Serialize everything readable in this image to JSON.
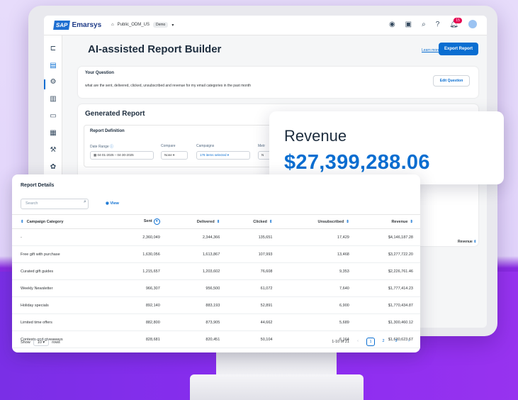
{
  "app": {
    "brand_sap": "SAP",
    "brand_name": "Emarsys",
    "tenant": "Public_ODM_US",
    "tenant_tag": "Demo"
  },
  "topbar": {
    "notifications": "15"
  },
  "page": {
    "title": "AI-assisted Report Builder",
    "learn_more": "Learn more",
    "export_label": "Export Report"
  },
  "question": {
    "label": "Your Question",
    "text": "what are the sent, delivered, clicked, unsubscribed and revenue for my email categories in the past month",
    "edit_label": "Edit Question"
  },
  "generated": {
    "title": "Generated Report",
    "definition_title": "Report Definition",
    "date_range_label": "Date Range",
    "date_range_value": "04-01-2025 – 04-30-2025",
    "compare_label": "Compare",
    "compare_value": "None",
    "campaigns_label": "Campaigns",
    "campaigns_value": "178 items selected",
    "metrics_label": "Metr",
    "metrics_value": "N",
    "revenue_header": "Revenue"
  },
  "revenue_popup": {
    "label": "Revenue",
    "value": "$27,399,288.06"
  },
  "details": {
    "title": "Report Details",
    "search_placeholder": "Search",
    "view_label": "View",
    "columns": [
      "Campaign Category",
      "Sent",
      "Delivered",
      "Clicked",
      "Unsubscribed",
      "Revenue"
    ],
    "rows": [
      [
        "-",
        "2,360,049",
        "2,344,366",
        "135,651",
        "17,429",
        "$4,146,187.28"
      ],
      [
        "Free gift with purchase",
        "1,630,056",
        "1,613,867",
        "107,993",
        "13,468",
        "$3,277,722.20"
      ],
      [
        "Curated gift guides",
        "1,215,657",
        "1,203,602",
        "76,608",
        "9,353",
        "$2,226,761.46"
      ],
      [
        "Weekly Newsletter",
        "966,307",
        "956,500",
        "61,072",
        "7,640",
        "$1,777,414.23"
      ],
      [
        "Holiday specials",
        "892,140",
        "883,193",
        "52,891",
        "6,900",
        "$1,770,434.87"
      ],
      [
        "Limited time offers",
        "882,800",
        "873,905",
        "44,662",
        "5,689",
        "$1,300,460.12"
      ],
      [
        "Contests and giveaways",
        "828,681",
        "820,451",
        "50,104",
        "6,164",
        "$1,630,623.67"
      ]
    ],
    "show_label": "Show",
    "rows_value": "10",
    "rows_label": "rows",
    "page_info": "1-10 of 21",
    "pages": [
      "1",
      "2",
      "3"
    ]
  }
}
